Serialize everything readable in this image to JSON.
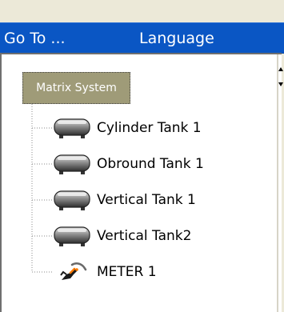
{
  "menubar": {
    "items": [
      {
        "label": "Go To ...",
        "icon": "none"
      },
      {
        "label": "Language",
        "icon": "none"
      }
    ],
    "background": "#0a56c4"
  },
  "tree": {
    "root": {
      "label": "Matrix System",
      "selected": true,
      "background": "#9f9b78"
    },
    "items": [
      {
        "label": "Cylinder Tank 1",
        "icon": "tank-icon"
      },
      {
        "label": "Obround Tank 1",
        "icon": "tank-icon"
      },
      {
        "label": "Vertical Tank 1",
        "icon": "tank-icon"
      },
      {
        "label": "Vertical Tank2",
        "icon": "tank-icon"
      },
      {
        "label": "METER 1",
        "icon": "fuel-nozzle-icon"
      }
    ]
  }
}
